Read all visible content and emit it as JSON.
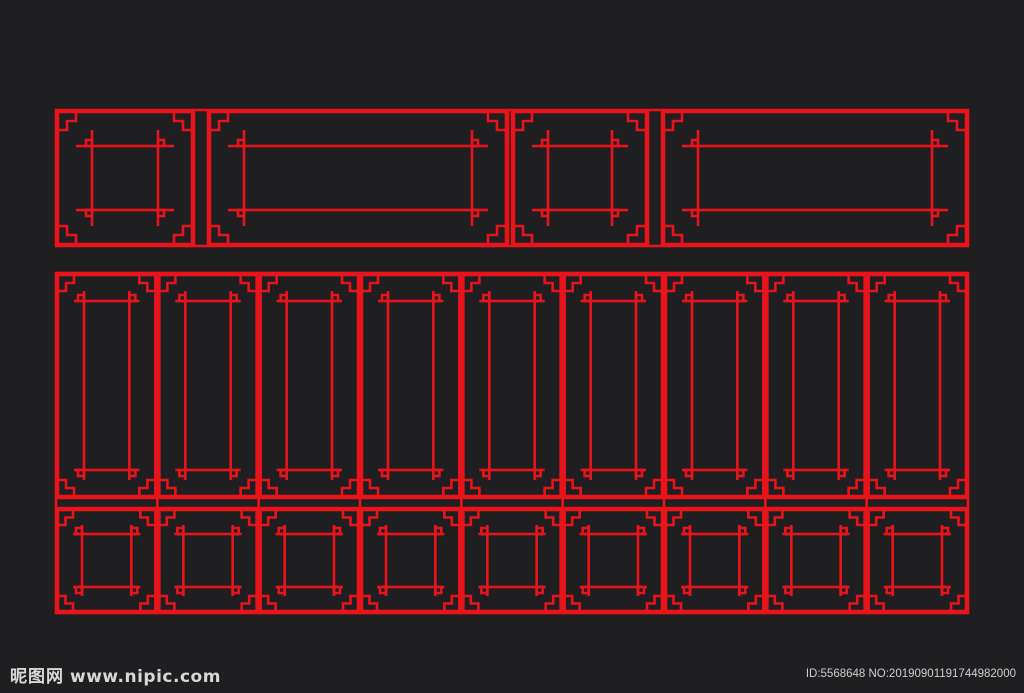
{
  "artwork": {
    "background": "#1f1e20",
    "line_color": "#e8141b",
    "top_panel": {
      "modules": [
        "square",
        "wide",
        "square",
        "wide"
      ]
    },
    "bottom_panel": {
      "columns": 9,
      "rows": [
        "tall",
        "square"
      ]
    }
  },
  "watermark": {
    "logo_cn": "昵图网",
    "logo_url": "www.nipic.com",
    "id_text": "ID:5568648 NO:20190901191744982000"
  }
}
